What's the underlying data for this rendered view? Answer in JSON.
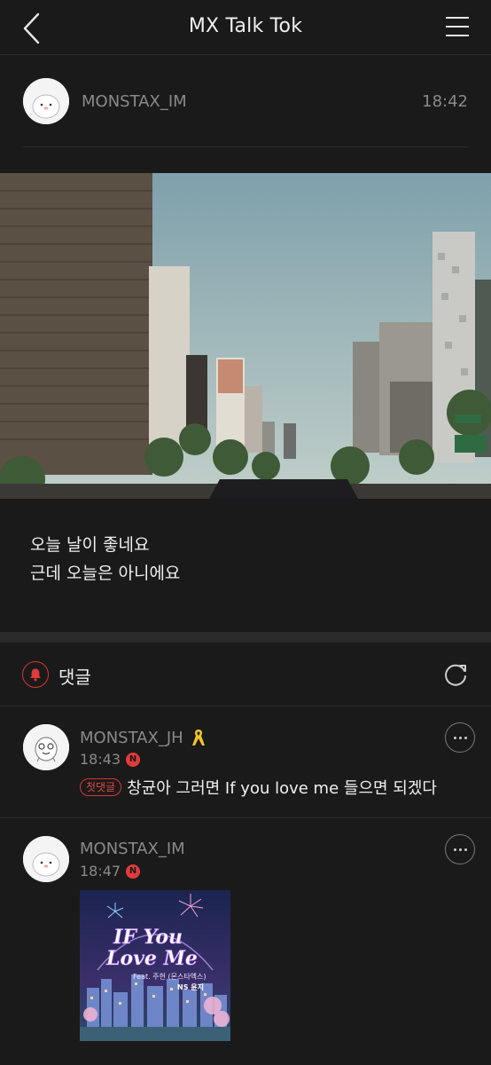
{
  "topbar": {
    "title": "MX Talk Tok"
  },
  "post": {
    "author": "MONSTAX_IM",
    "time": "18:42",
    "lines": [
      "오늘 날이 좋네요",
      "근데 오늘은 아니에요"
    ]
  },
  "comments_section": {
    "label": "댓글"
  },
  "comments": [
    {
      "author": "MONSTAX_JH",
      "time": "18:43",
      "badge": "N",
      "first_label": "첫댓글",
      "text": "창균아 그러면 If you love me 들으면 되겠다"
    },
    {
      "author": "MONSTAX_IM",
      "time": "18:47",
      "badge": "N",
      "album": {
        "title_line1": "IF You",
        "title_line2": "Love Me",
        "feat": "Feat. 주헌 (몬스타엑스)",
        "brand": "NS 윤지"
      }
    }
  ],
  "colors": {
    "accent": "#dd3333",
    "background": "#1a1a1a",
    "muted": "#8a8a8a"
  }
}
